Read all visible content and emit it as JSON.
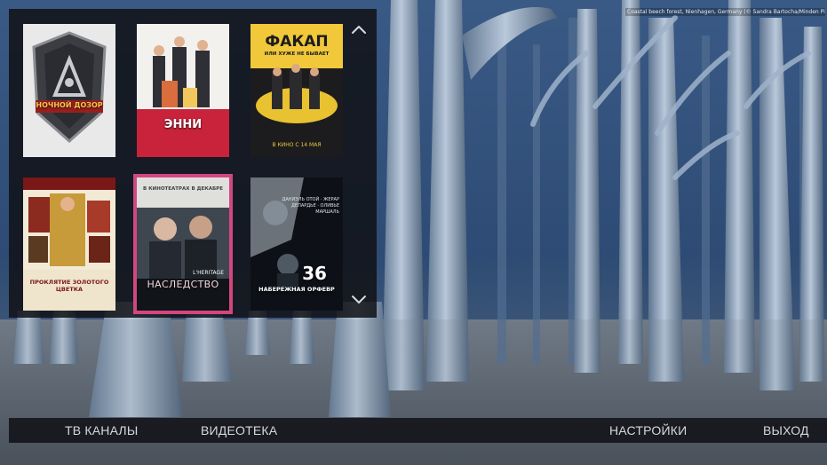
{
  "background": {
    "credit": "Coastal beech forest, Nienhagen, Germany (© Sandra Bartocha/Minden Pictures)"
  },
  "navigation": {
    "scroll_up_icon": "chevron-up-icon",
    "scroll_down_icon": "chevron-down-icon"
  },
  "posters": [
    {
      "title": "НОЧНОЙ ДОЗОР",
      "subtitle": ""
    },
    {
      "title": "ЭННИ",
      "subtitle": ""
    },
    {
      "title": "ФАКАП",
      "subtitle": "ИЛИ ХУЖЕ НЕ БЫВАЕТ",
      "tagline": "В КИНО С 14 МАЯ"
    },
    {
      "title": "ПРОКЛЯТИЕ ЗОЛОТОГО ЦВЕТКА",
      "subtitle": ""
    },
    {
      "title": "НАСЛЕДСТВО",
      "subtitle": "В КИНОТЕАТРАХ В ДЕКАБРЕ",
      "tagline": "L'HERITAGE"
    },
    {
      "title": "НАБЕРЕЖНАЯ ОРФЕВР",
      "subtitle": "36",
      "tagline": "ДАНИЭЛЬ ОТОЙ · ЖЕРАР ДЕПАРДЬЕ · ОЛИВЬЕ МАРШАЛЬ"
    }
  ],
  "menu": {
    "tv_channels": "ТВ КАНАЛЫ",
    "video_library": "ВИДЕОТЕКА",
    "settings": "НАСТРОЙКИ",
    "exit": "ВЫХОД"
  },
  "colors": {
    "selection": "#d2477f",
    "panel": "#101216",
    "menu_text": "#d5d8dc"
  }
}
